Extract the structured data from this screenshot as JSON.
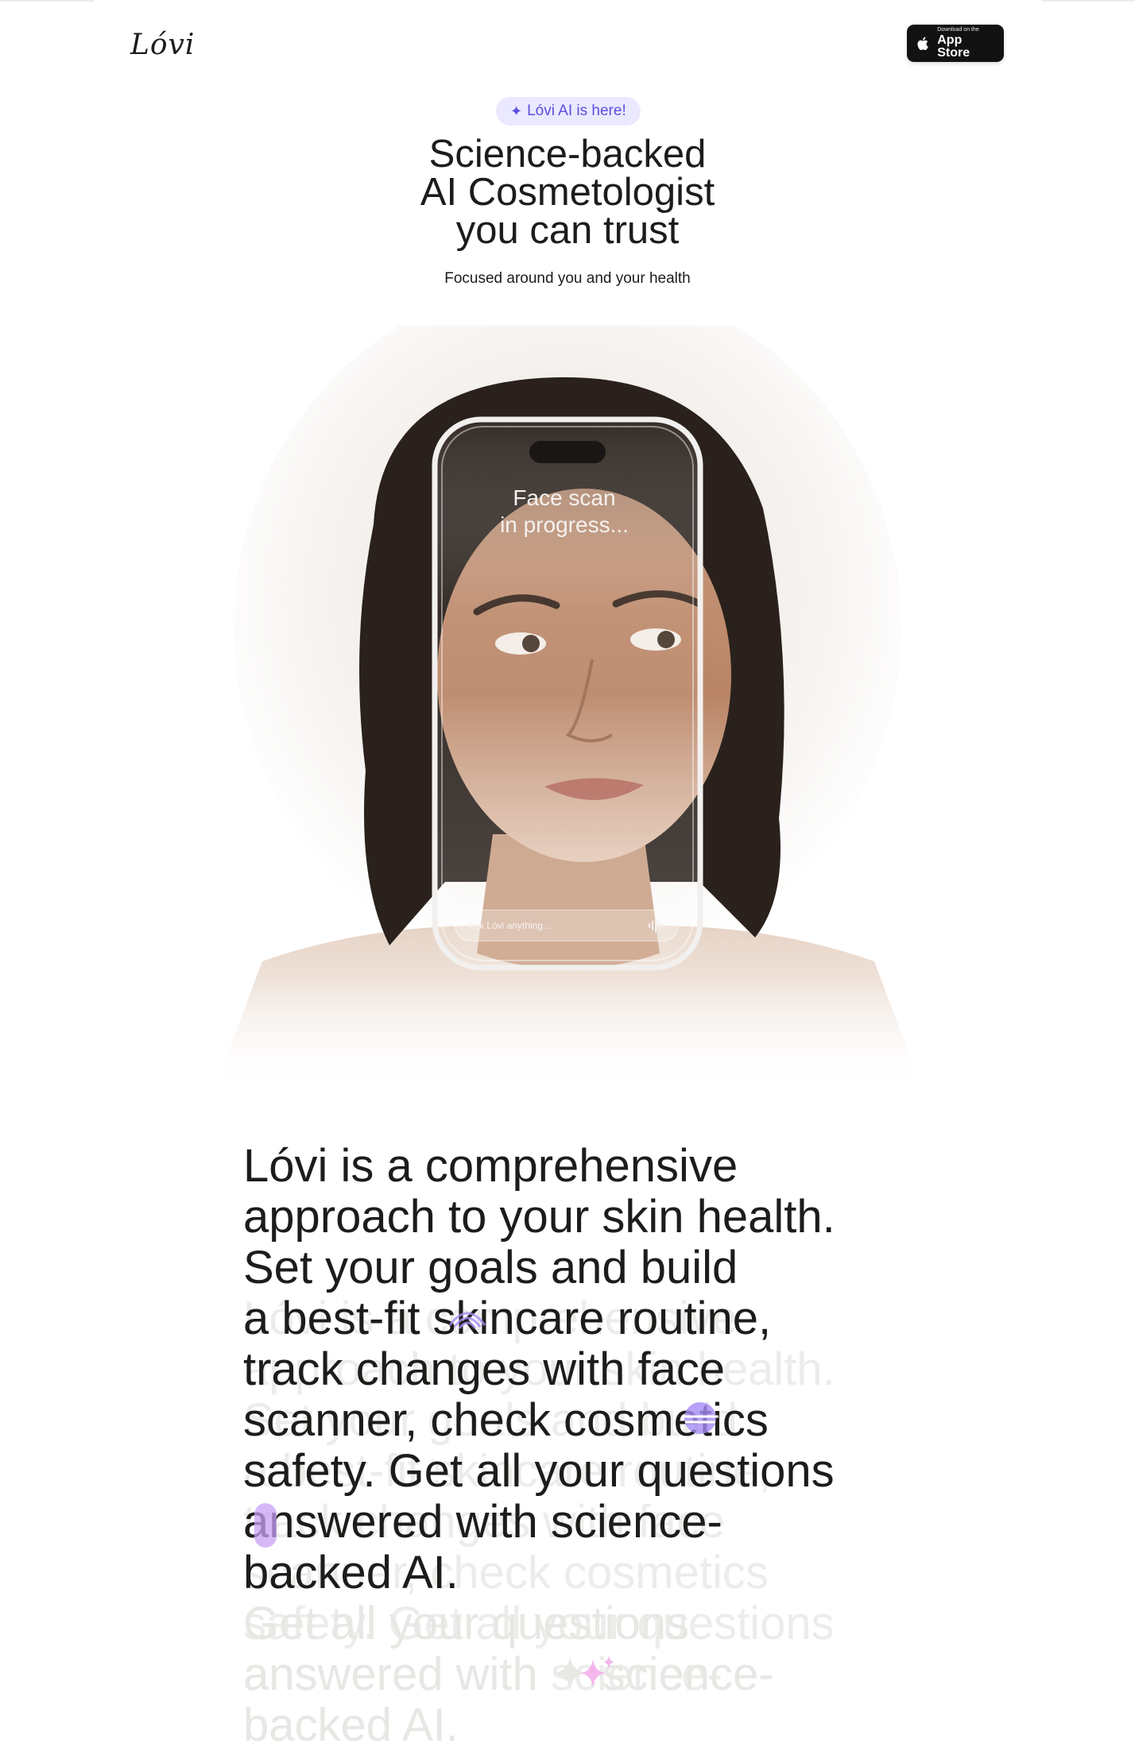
{
  "header": {
    "logo_text": "Lóvi",
    "appstore_small": "Download on the",
    "appstore_big": "App Store"
  },
  "hero": {
    "badge": "Lóvi AI is here!",
    "title": "Science-backed\nAI Cosmetologist\nyou can trust",
    "subtitle": "Focused around you and your health",
    "phone_status": "Face scan\nin progress...",
    "ask_placeholder": "Ask Lóvi anything..."
  },
  "story": {
    "main_text": "Lóvi is a comprehensive\napproach to your skin health.\nSet your goals and build\na best-fit skincare routine,\ntrack changes with face\nscanner, check cosmetics\nsafety. Get all your questions\nanswered with science-\nbacked AI.",
    "faded_text": "Get all your questions\nanswered with ✦ science-\nbacked AI."
  },
  "colors": {
    "accent": "#5b4ee0",
    "badge_bg": "#ebe9ff",
    "text": "#1e1c1a",
    "faded": "#e9e7e4",
    "deco_purple": "#a58cf5",
    "deco_pink": "#f3a6e8"
  },
  "icons": {
    "apple": "apple-logo-icon",
    "sparkle": "sparkle-icon",
    "voice": "voice-wave-icon"
  }
}
